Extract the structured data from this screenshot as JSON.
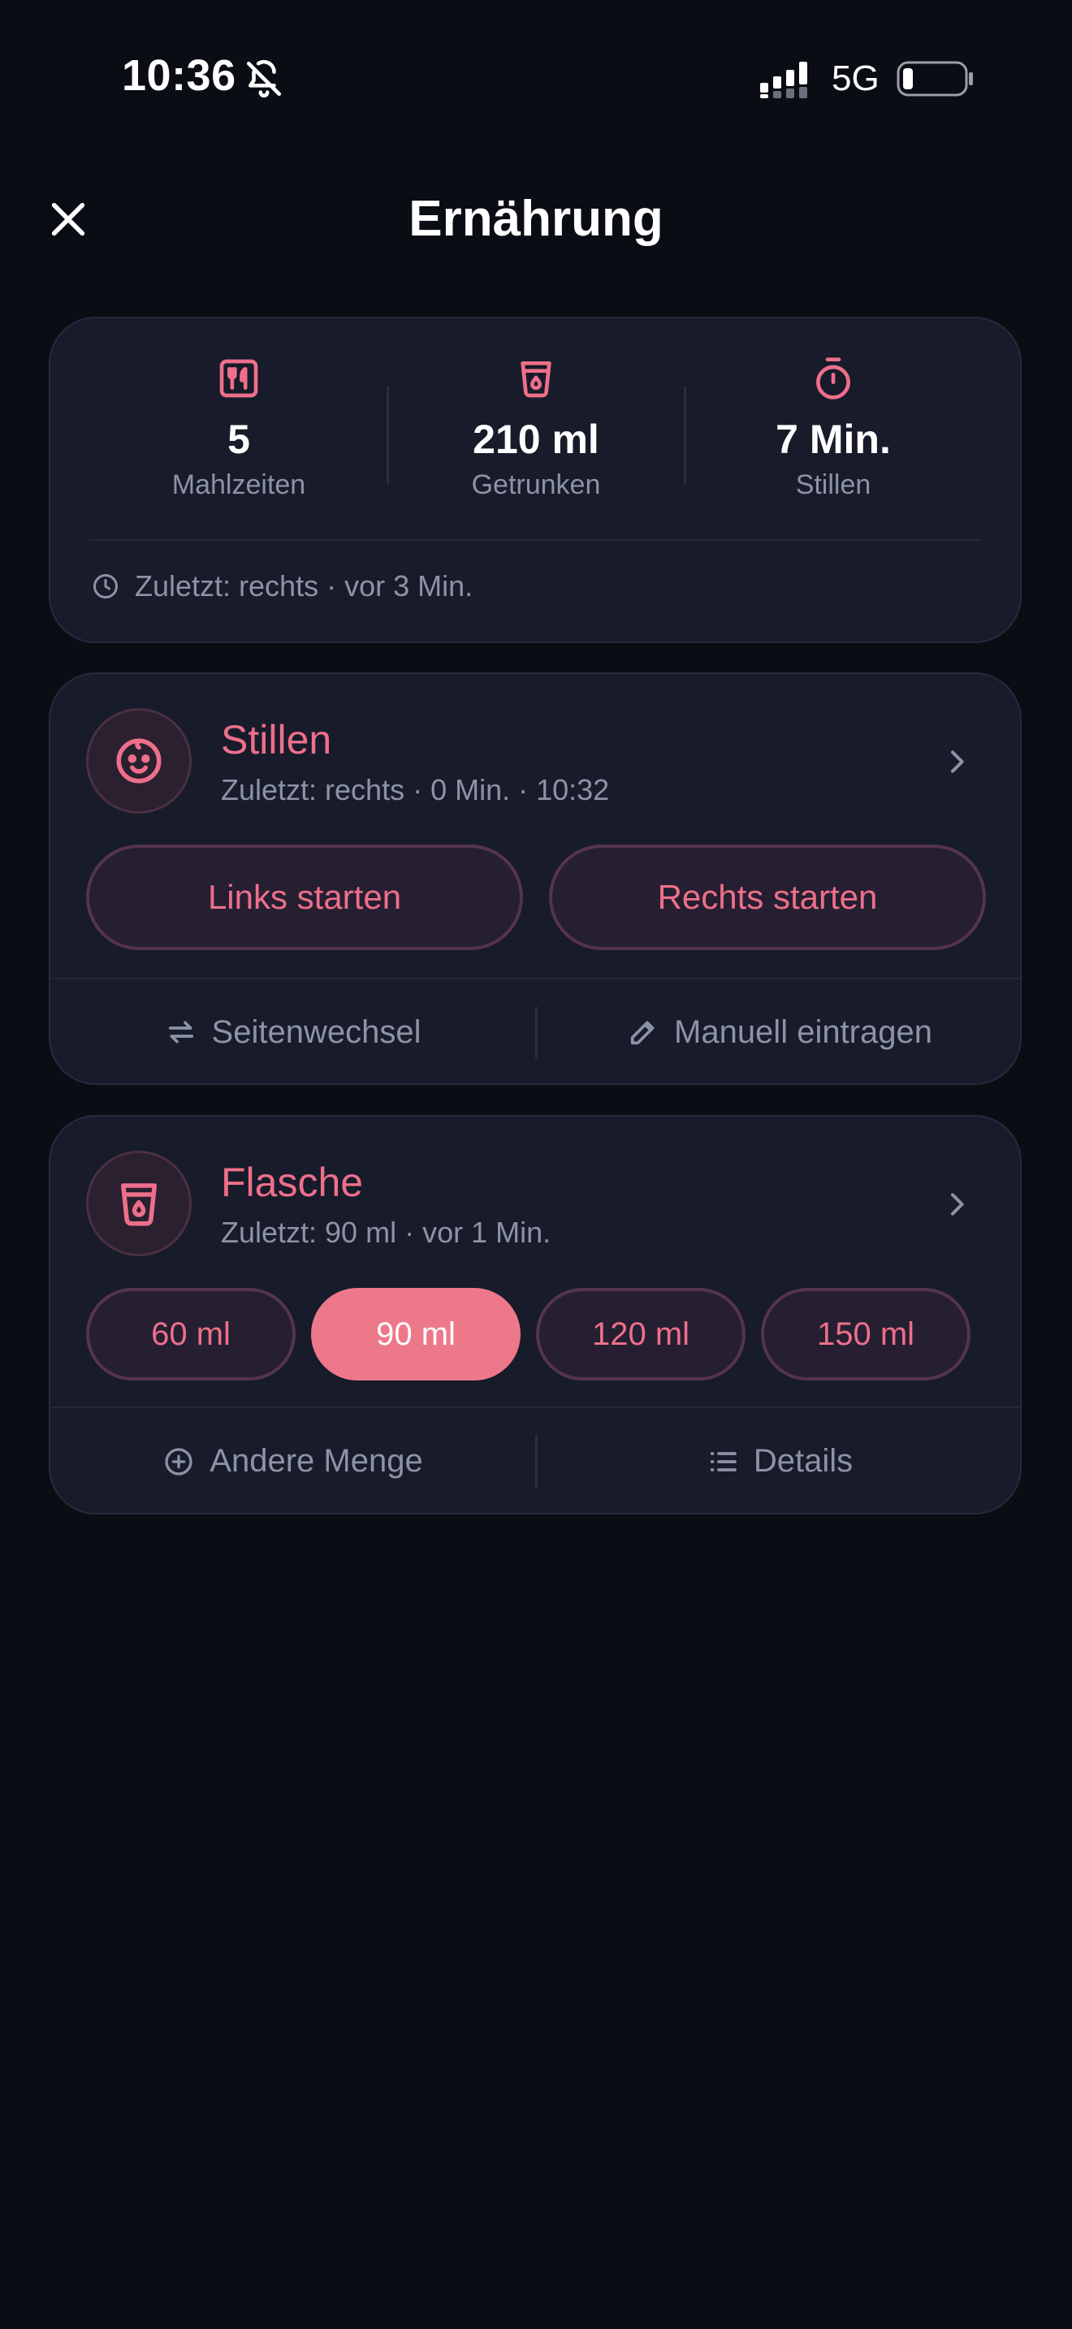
{
  "status_bar": {
    "time": "10:36",
    "network": "5G",
    "icons": [
      "bell-off-icon",
      "signal-icon",
      "battery-icon"
    ]
  },
  "header": {
    "title": "Ernährung",
    "close_icon": "close-icon"
  },
  "colors": {
    "background": "#0b0d15",
    "card": "#171b2a",
    "accent": "#ee6f8b",
    "accent_fill": "#ec7889",
    "muted_text": "#8d93a6"
  },
  "summary": {
    "stats": [
      {
        "icon": "meals-icon",
        "value": "5",
        "label": "Mahlzeiten"
      },
      {
        "icon": "cup-icon",
        "value": "210 ml",
        "label": "Getrunken"
      },
      {
        "icon": "timer-icon",
        "value": "7 Min.",
        "label": "Stillen"
      }
    ],
    "last": "Zuletzt: rechts · vor 3 Min."
  },
  "stillen": {
    "title": "Stillen",
    "subtitle": "Zuletzt: rechts · 0 Min. · 10:32",
    "buttons": {
      "left": "Links starten",
      "right": "Rechts starten"
    },
    "actions": {
      "switch": "Seitenwechsel",
      "manual": "Manuell eintragen"
    }
  },
  "flasche": {
    "title": "Flasche",
    "subtitle": "Zuletzt: 90 ml · vor 1 Min.",
    "amounts": [
      "60 ml",
      "90 ml",
      "120 ml",
      "150 ml"
    ],
    "selected_amount": "90 ml",
    "actions": {
      "other": "Andere Menge",
      "details": "Details"
    }
  }
}
